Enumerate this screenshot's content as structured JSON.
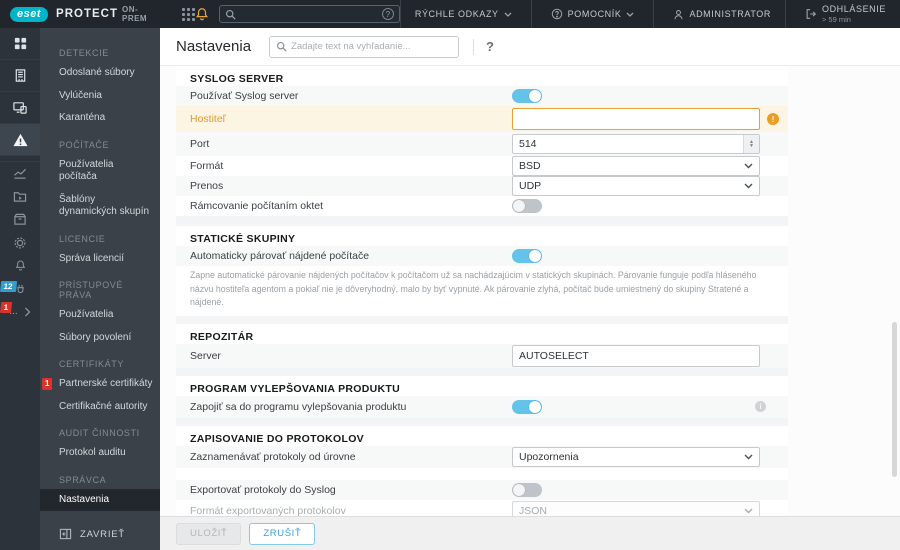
{
  "colors": {
    "accent_blue": "#64c3e8",
    "warning_orange": "#ed9c23",
    "badge_red": "#d9342b",
    "badge_blue": "#2f9fd0",
    "brand_teal": "#00b5ca",
    "topbar_bg": "#20262c"
  },
  "topbar": {
    "logo_text": "eset",
    "product": "PROTECT",
    "edition": "ON-PREM",
    "icons": [
      "app-grid",
      "bell",
      "search",
      "help-circle"
    ],
    "search_value": "",
    "search_help": "?",
    "quick_links_label": "RÝCHLE ODKAZY",
    "help_label": "POMOCNÍK",
    "user_label": "ADMINISTRATOR",
    "logout_label": "ODHLÁSENIE",
    "logout_timer": "> 59 min"
  },
  "rail": {
    "badge_status": "12",
    "badge_more": "1",
    "more_dots": "..."
  },
  "sidebar": {
    "sections": [
      {
        "title": "DETEKCIE",
        "items": [
          "Odoslané súbory",
          "Vylúčenia",
          "Karanténa"
        ]
      },
      {
        "title": "POČÍTAČE",
        "items": [
          "Používatelia počítača",
          "Šablóny dynamických skupín"
        ]
      },
      {
        "title": "LICENCIE",
        "items": [
          "Správa licencií"
        ]
      },
      {
        "title": "PRÍSTUPOVÉ PRÁVA",
        "items": [
          "Používatelia",
          "Súbory povolení"
        ]
      },
      {
        "title": "CERTIFIKÁTY",
        "items": [
          "Partnerské certifikáty",
          "Certifikačné autority"
        ],
        "badge": "1"
      },
      {
        "title": "AUDIT ČINNOSTI",
        "items": [
          "Protokol auditu"
        ]
      },
      {
        "title": "SPRÁVCA",
        "items": [
          "Nastavenia"
        ]
      }
    ],
    "active_item": "Nastavenia",
    "close_label": "ZAVRIEŤ"
  },
  "header": {
    "title": "Nastavenia",
    "search_placeholder": "Zadajte text na vyhľadanie...",
    "help_icon": "?"
  },
  "sections": {
    "syslog": {
      "title": "SYSLOG SERVER",
      "use_label": "Používať Syslog server",
      "use_enabled": true,
      "host_label": "Hostiteľ",
      "host_value": "",
      "host_error": "!",
      "port_label": "Port",
      "port_value": "514",
      "format_label": "Formát",
      "format_value": "BSD",
      "transport_label": "Prenos",
      "transport_value": "UDP",
      "framing_label": "Rámcovanie počítaním oktet",
      "framing_enabled": false
    },
    "static_groups": {
      "title": "STATICKÉ SKUPINY",
      "pair_label": "Automaticky párovať nájdené počítače",
      "pair_enabled": true,
      "description": "Zapne automatické párovanie nájdených počítačov k počítačom už sa nachádzajúcim v statických skupinách. Párovanie funguje podľa hláseného názvu hostiteľa agentom a pokiaľ nie je dôveryhodný, malo by byť vypnuté. Ak párovanie zlyhá, počítač bude umiestnený do skupiny Stratené a nájdené."
    },
    "repository": {
      "title": "REPOZITÁR",
      "server_label": "Server",
      "server_value": "AUTOSELECT"
    },
    "improvement": {
      "title": "PROGRAM VYLEPŠOVANIA PRODUKTU",
      "join_label": "Zapojiť sa do programu vylepšovania produktu",
      "join_enabled": true,
      "info_icon": "i"
    },
    "logging": {
      "title": "ZAPISOVANIE DO PROTOKOLOV",
      "level_label": "Zaznamenávať protokoly od úrovne",
      "level_value": "Upozornenia",
      "export_label": "Exportovať protokoly do Syslog",
      "export_enabled": false,
      "export_format_label": "Formát exportovaných protokolov",
      "export_format_value": "JSON"
    }
  },
  "footer": {
    "save_label": "ULOŽIŤ",
    "cancel_label": "ZRUŠIŤ"
  }
}
